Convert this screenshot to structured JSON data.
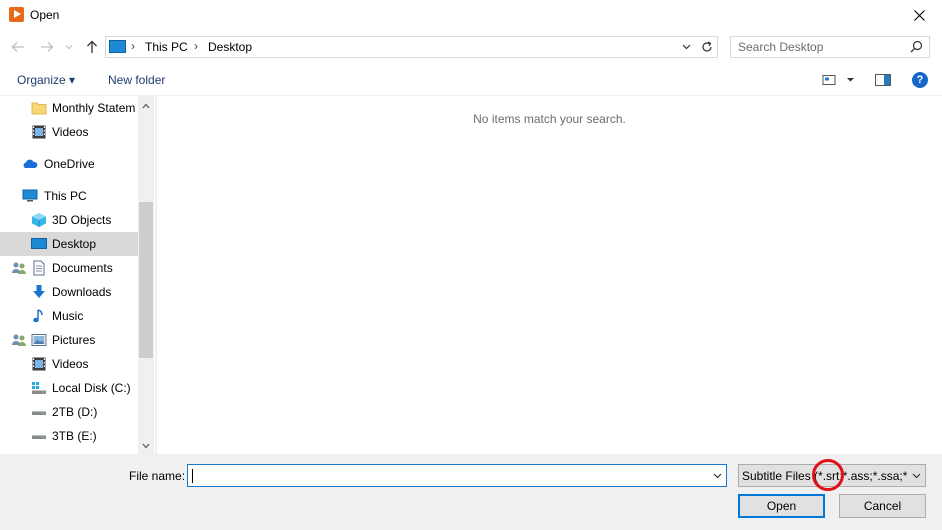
{
  "window": {
    "title": "Open",
    "close_glyph": "✕"
  },
  "toolbar": {
    "back_glyph": "←",
    "forward_glyph": "→",
    "recent_glyph": "⌄",
    "up_glyph": "↑"
  },
  "address": {
    "crumbs": [
      "This PC",
      "Desktop"
    ],
    "separator": "›"
  },
  "search": {
    "placeholder": "Search Desktop"
  },
  "commands": {
    "organize": "Organize ▾",
    "new_folder": "New folder"
  },
  "nav": {
    "items": [
      {
        "label": "Monthly Statem",
        "icon": "folder-icon"
      },
      {
        "label": "Videos",
        "icon": "videos-icon"
      },
      {
        "label": "OneDrive",
        "icon": "onedrive-icon"
      },
      {
        "label": "This PC",
        "icon": "this-pc-icon"
      },
      {
        "label": "3D Objects",
        "icon": "3d-objects-icon"
      },
      {
        "label": "Desktop",
        "icon": "desktop-icon",
        "selected": true
      },
      {
        "label": "Documents",
        "icon": "documents-icon"
      },
      {
        "label": "Downloads",
        "icon": "downloads-icon"
      },
      {
        "label": "Music",
        "icon": "music-icon"
      },
      {
        "label": "Pictures",
        "icon": "pictures-icon"
      },
      {
        "label": "Videos",
        "icon": "videos-icon"
      },
      {
        "label": "Local Disk (C:)",
        "icon": "local-disk-icon"
      },
      {
        "label": "2TB (D:)",
        "icon": "drive-icon"
      },
      {
        "label": "3TB (E:)",
        "icon": "drive-icon"
      }
    ]
  },
  "content": {
    "empty_message": "No items match your search."
  },
  "footer": {
    "file_name_label": "File name:",
    "file_name_value": "",
    "file_type": "Subtitle Files (*.srt;*.ass;*.ssa;*.idx;*.sub)",
    "open_label": "Open",
    "cancel_label": "Cancel"
  },
  "colors": {
    "accent": "#0078d7",
    "selected_bg": "#d9d9d9",
    "annotation": "#e0101a"
  }
}
